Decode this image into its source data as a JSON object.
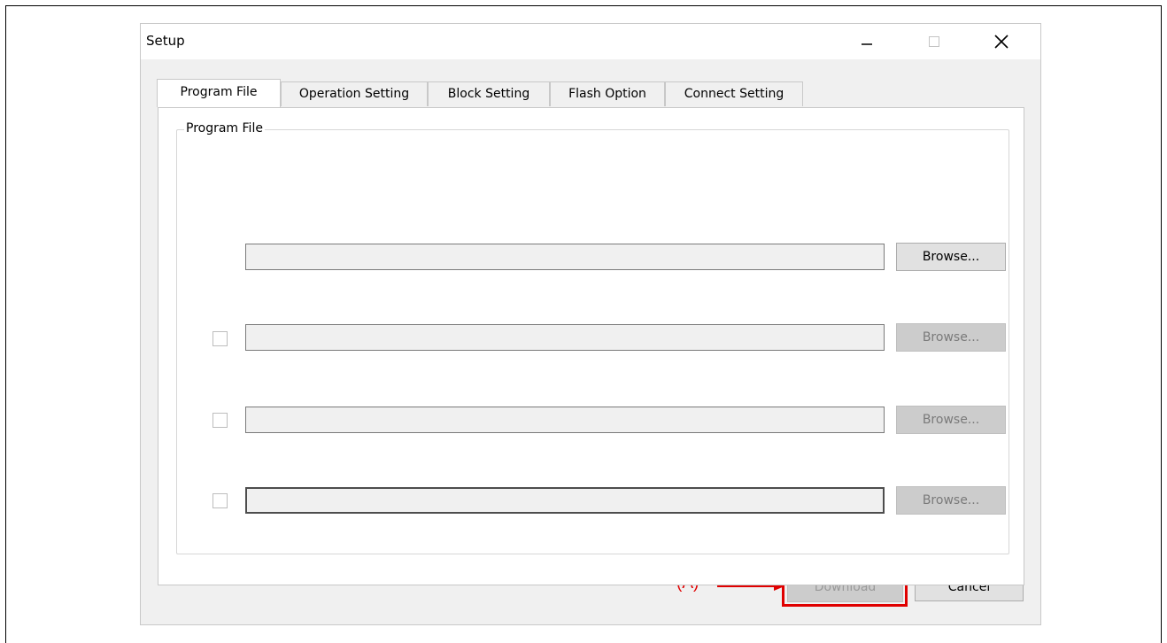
{
  "window": {
    "title": "Setup"
  },
  "tabs": [
    {
      "label": "Program File"
    },
    {
      "label": "Operation Setting"
    },
    {
      "label": "Block Setting"
    },
    {
      "label": "Flash Option"
    },
    {
      "label": "Connect Setting"
    }
  ],
  "group": {
    "label": "Program File"
  },
  "file_rows": [
    {
      "value": "",
      "browse_label": "Browse...",
      "has_checkbox": false,
      "checked": false,
      "browse_enabled": true
    },
    {
      "value": "",
      "browse_label": "Browse...",
      "has_checkbox": true,
      "checked": false,
      "browse_enabled": false
    },
    {
      "value": "",
      "browse_label": "Browse...",
      "has_checkbox": true,
      "checked": false,
      "browse_enabled": false
    },
    {
      "value": "",
      "browse_label": "Browse...",
      "has_checkbox": true,
      "checked": false,
      "browse_enabled": false
    }
  ],
  "buttons": {
    "download": "Download",
    "cancel": "Cancel"
  },
  "annotation": {
    "label": "(A)",
    "color": "#e00000"
  },
  "icons": {
    "minimize": "minimize-icon",
    "maximize": "maximize-icon",
    "close": "close-icon"
  }
}
